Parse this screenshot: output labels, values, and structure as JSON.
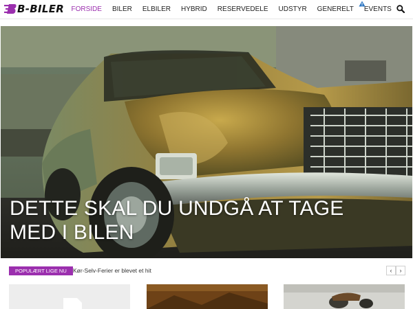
{
  "site": {
    "logo_text": "B-BILER",
    "brand_color": "#9b2fae"
  },
  "nav": {
    "items": [
      {
        "label": "FORSIDE",
        "active": true
      },
      {
        "label": "BILER",
        "active": false
      },
      {
        "label": "ELBILER",
        "active": false
      },
      {
        "label": "HYBRID",
        "active": false
      },
      {
        "label": "RESERVEDELE",
        "active": false
      },
      {
        "label": "UDSTYR",
        "active": false
      },
      {
        "label": "GENERELT",
        "active": false
      },
      {
        "label": "EVENTS",
        "active": false
      }
    ],
    "icons": [
      "warning-icon",
      "search-icon"
    ]
  },
  "hero": {
    "title": "DETTE SKAL DU UNDGÅ AT TAGE MED I BILEN"
  },
  "ticker": {
    "label": "POPULÆRT LIGE NU",
    "headline": "Kør-Selv-Ferier er blevet et hit",
    "prev_symbol": "‹",
    "next_symbol": "›"
  },
  "cards": [
    {
      "kind": "placeholder"
    },
    {
      "kind": "photo"
    },
    {
      "kind": "photo"
    }
  ]
}
